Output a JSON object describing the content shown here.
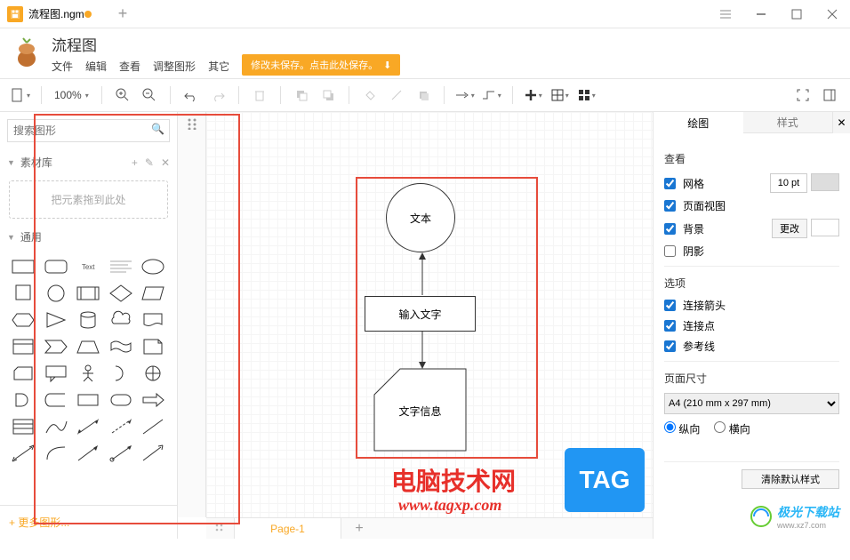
{
  "titlebar": {
    "tab_name": "流程图.ngm",
    "dirty": true
  },
  "header": {
    "title": "流程图",
    "menus": [
      "文件",
      "编辑",
      "查看",
      "调整图形",
      "其它"
    ],
    "save_banner": "修改未保存。点击此处保存。"
  },
  "toolbar": {
    "zoom": "100%"
  },
  "left_panel": {
    "search_placeholder": "搜索图形",
    "library_title": "素材库",
    "drop_hint": "把元素拖到此处",
    "general_title": "通用",
    "text_shape_label": "Text",
    "more_shapes": "+ 更多图形..."
  },
  "canvas": {
    "circle_text": "文本",
    "rect_text": "输入文字",
    "hex_text": "文字信息"
  },
  "right_panel": {
    "tab_draw": "绘图",
    "tab_style": "样式",
    "view_title": "查看",
    "grid_label": "网格",
    "grid_size": "10 pt",
    "page_view_label": "页面视图",
    "bg_label": "背景",
    "bg_change": "更改",
    "shadow_label": "阴影",
    "options_title": "选项",
    "conn_arrow": "连接箭头",
    "conn_point": "连接点",
    "guide_line": "参考线",
    "page_size_title": "页面尺寸",
    "page_size_value": "A4 (210 mm x 297 mm)",
    "portrait": "纵向",
    "landscape": "横向",
    "clear_default": "清除默认样式"
  },
  "bottom": {
    "page_tab": "Page-1"
  },
  "overlays": {
    "red_text": "电脑技术网",
    "red_url": "www.tagxp.com",
    "tag_text": "TAG",
    "jg_text": "极光下载站",
    "jg_url": "www.xz7.com"
  }
}
